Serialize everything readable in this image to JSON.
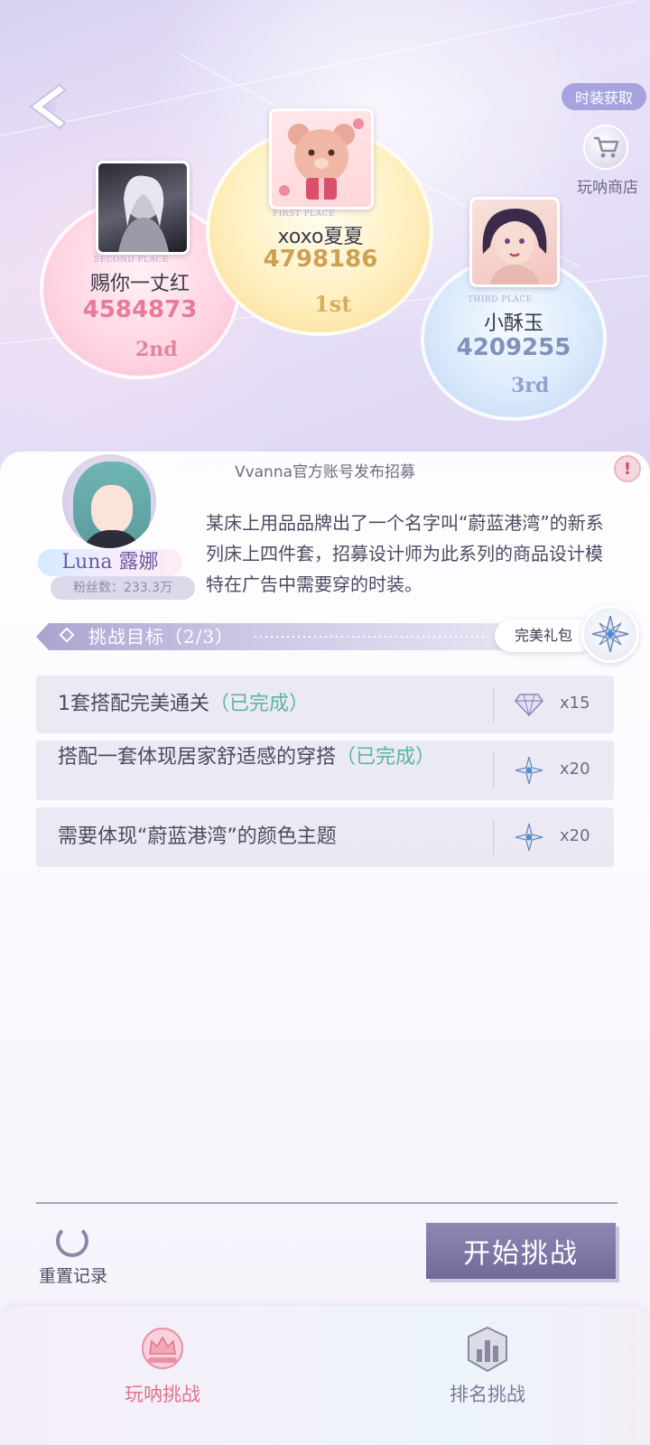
{
  "header": {
    "fashion_acquire_label": "时装获取",
    "shop_label": "玩呐商店"
  },
  "leaderboard": {
    "first": {
      "tag": "FIRST PLACE",
      "name": "xoxo夏夏",
      "score": "4798186",
      "rank": "1st"
    },
    "second": {
      "tag": "SECOND PLACE",
      "name": "赐你一丈红",
      "score": "4584873",
      "rank": "2nd"
    },
    "third": {
      "tag": "THIRD PLACE",
      "name": "小酥玉",
      "score": "4209255",
      "rank": "3rd"
    }
  },
  "post": {
    "title": "Vvanna官方账号发布招募",
    "npc_name": "Luna 露娜",
    "npc_fans": "粉丝数：233.3万",
    "description": "某床上用品品牌出了一个名字叫“蔚蓝港湾”的新系列床上四件套，招募设计师为此系列的商品设计模特在广告中需要穿的时装。"
  },
  "objectives": {
    "title": "挑战目标（2/3）",
    "gift_label": "完美礼包",
    "tasks": [
      {
        "text": "1套搭配完美通关",
        "status": "（已完成）",
        "qty": "x15",
        "reward_icon": "diamond-icon"
      },
      {
        "text": "搭配一套体现居家舒适感的穿搭",
        "status": "（已完成）",
        "qty": "x20",
        "reward_icon": "star-crystal-icon"
      },
      {
        "text": "需要体现“蔚蓝港湾”的颜色主题",
        "status": "",
        "qty": "x20",
        "reward_icon": "star-crystal-icon"
      }
    ]
  },
  "actions": {
    "reset_label": "重置记录",
    "start_label": "开始挑战"
  },
  "tabs": [
    {
      "label": "玩呐挑战",
      "active": true,
      "color": "#e0728c"
    },
    {
      "label": "排名挑战",
      "active": false,
      "color": "#7d7b96"
    }
  ],
  "colors": {
    "second_score": "#e87a9a",
    "first_score": "#cda052",
    "third_score": "#7f93b8",
    "done_status": "#5bb5a4",
    "start_button": "#7a75a3"
  }
}
